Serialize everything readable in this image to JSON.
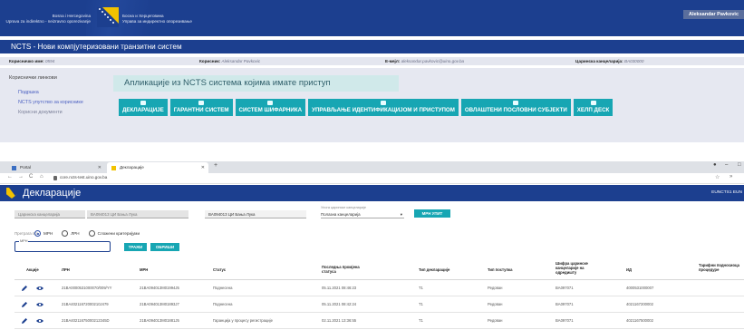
{
  "portal": {
    "org_left_line1": "Bosna i Hercegovina",
    "org_left_line2": "Uprava za indirektno - neizravno oporezivanje",
    "org_right_line1": "Босна и Херцеговина",
    "org_right_line2": "Управа за индиректно опорезивање",
    "user": "Aleksandar Pavkovic",
    "app_title": "NCTS - Нови компјутеризовани транзитни систем",
    "info": {
      "username_label": "Корисничко име:",
      "username_value": "0594",
      "user_label": "Корисник:",
      "user_value": "Aleksandar Pavkovic",
      "email_label": "Е-мејл:",
      "email_value": "aleksandar.pavkovic@uino.gov.ba",
      "office_label": "Царинска канцеларија:",
      "office_value": "BA030000"
    },
    "side_menu": {
      "title": "Кориснички линкови",
      "items": [
        "Подршка",
        "NCTS упутство за кориснике",
        "Корисни документи"
      ]
    },
    "apps_heading": "Апликације из NCTS система којима имате приступ",
    "tiles": [
      "ДЕКЛАРАЦИЈЕ",
      "ГАРАНТНИ СИСТЕМ",
      "СИСТЕМ ШИФАРНИКА",
      "УПРАВЉАЊЕ ИДЕНТИФИКАЦИЈОМ И ПРИСТУПОМ",
      "ОВЛАШТЕНИ ПОСЛОВНИ СУБЈЕКТИ",
      "ХЕЛП ДЕСК"
    ]
  },
  "browser": {
    "tabs": [
      "Portal",
      "Декларације"
    ],
    "url": "core.ncts-test.uino.gov.ba"
  },
  "app": {
    "title": "Декларације",
    "env": "EUNCTS1 EUN",
    "filters": {
      "office_type": "Царинска канцеларија",
      "office_value": "BA094013 ЦИ Бања Лука",
      "office_code": "BA094013 ЦИ Бања Лука",
      "type_label": "Улога царинске канцеларије",
      "type_value": "Полазна канцеларија",
      "mrn_button": "МРН УПИТ",
      "search_by_label": "Претрага по:",
      "radios": [
        "МРН",
        "ЛРН",
        "Сложени критеријуми"
      ],
      "mrn_field_label": "МРН",
      "search_button": "ТРАЖИ",
      "clear_button": "ОБРИШИ"
    },
    "table": {
      "headers": {
        "actions": "Акције",
        "lrn": "ЛРН",
        "mrn": "МРН",
        "status": "Статус",
        "last_check_l1": "Последња промјена",
        "last_check_l2": "статуса",
        "decl_type": "Тип декларације",
        "proc_type": "Тип поступка",
        "office_l1": "Шифра царинске",
        "office_l2": "канцеларије на",
        "office_l3": "одредишту",
        "id": "ИД",
        "holder_l1": "Тарифни подносиоца",
        "holder_l2": "процедуре"
      },
      "rows": [
        {
          "lrn": "21BA0000531000070/009/YY",
          "mrn": "21BA094013M01994J5",
          "status": "Поднесена",
          "changed": "05.11.2021 08:46:23",
          "decl": "T1",
          "proc": "Редован",
          "office": "BA097071",
          "id": "4000531000007"
        },
        {
          "lrn": "21BA40211672000210J479",
          "mrn": "21BA094013M01893J7",
          "status": "Поднесена",
          "changed": "05.11.2021 08:42:24",
          "decl": "T1",
          "proc": "Редован",
          "office": "BA097071",
          "id": "4021167200002"
        },
        {
          "lrn": "21BA40211675000212345D",
          "mrn": "21BA094013M01881J5",
          "status": "Гаранција у процесу регистрације",
          "changed": "02.11.2021 13:36:55",
          "decl": "T1",
          "proc": "Редован",
          "office": "BA097071",
          "id": "4021167500002"
        }
      ]
    }
  }
}
